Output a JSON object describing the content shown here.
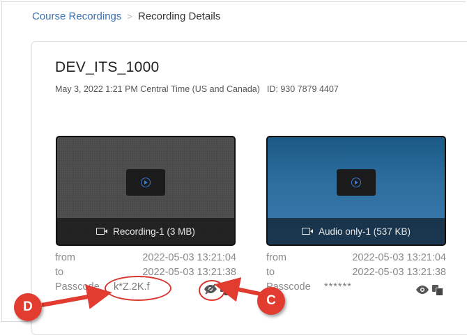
{
  "breadcrumb": {
    "parent": "Course Recordings",
    "separator": ">",
    "current": "Recording Details"
  },
  "meeting": {
    "title": "DEV_ITS_1000",
    "datetime": "May 3, 2022 1:21 PM Central Time (US and Canada)",
    "meeting_id": "ID: 930 7879 4407"
  },
  "recordings": [
    {
      "caption": "Recording-1 (3 MB)",
      "from_label": "from",
      "from_value": "2022-05-03 13:21:04",
      "to_label": "to",
      "to_value": "2022-05-03 13:21:38",
      "passcode_label": "Passcode",
      "passcode_value": "k*Z.2K.f",
      "eye_icon": "eye-slash-icon",
      "copy_icon": "copy-icon"
    },
    {
      "caption": "Audio only-1 (537 KB)",
      "from_label": "from",
      "from_value": "2022-05-03 13:21:04",
      "to_label": "to",
      "to_value": "2022-05-03 13:21:38",
      "passcode_label": "Passcode",
      "passcode_value": "******",
      "eye_icon": "eye-icon",
      "copy_icon": "copy-icon"
    }
  ],
  "annotations": {
    "badge_d": "D",
    "badge_c": "C",
    "color": "#e23b2f"
  },
  "colors": {
    "link": "#3a6fb0",
    "play_icon": "#3d7ad8",
    "thumb_audio": "#2f6f9f",
    "thumb_video": "#4a4a4a"
  }
}
